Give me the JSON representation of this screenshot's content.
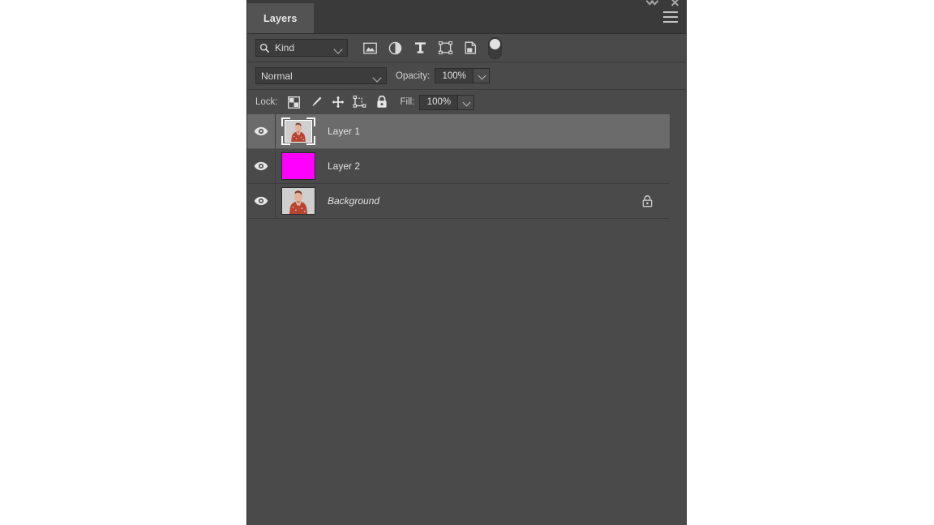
{
  "window": {
    "collapse_icon": "collapse-arrows-icon",
    "close_icon": "close-icon"
  },
  "panel": {
    "tab_label": "Layers",
    "menu_icon": "hamburger-menu-icon",
    "accent_selected_row": "#6b6b6b",
    "background": "#4a4a4a"
  },
  "filter": {
    "search_icon": "search-icon",
    "kind_label": "Kind",
    "kind_chevron": "chevron-down-icon",
    "icons": [
      {
        "name": "filter-pixel-layers-icon",
        "title": "Pixel layers"
      },
      {
        "name": "filter-adjustment-layers-icon",
        "title": "Adjustment layers"
      },
      {
        "name": "filter-type-layers-icon",
        "title": "Type layers"
      },
      {
        "name": "filter-shape-layers-icon",
        "title": "Shape layers"
      },
      {
        "name": "filter-smart-object-layers-icon",
        "title": "Smart objects"
      }
    ],
    "toggle": {
      "name": "filter-enable-toggle",
      "state": "on"
    }
  },
  "blend": {
    "mode": "Normal",
    "mode_chevron": "chevron-down-icon",
    "opacity_label": "Opacity:",
    "opacity_value": "100%",
    "opacity_chevron": "chevron-down-icon"
  },
  "lock": {
    "label": "Lock:",
    "icons": [
      {
        "name": "lock-transparent-pixels-icon"
      },
      {
        "name": "lock-image-pixels-icon"
      },
      {
        "name": "lock-position-icon"
      },
      {
        "name": "lock-artboard-nesting-icon"
      },
      {
        "name": "lock-all-icon"
      }
    ],
    "fill_label": "Fill:",
    "fill_value": "100%",
    "fill_chevron": "chevron-down-icon"
  },
  "layers": [
    {
      "name": "Layer 1",
      "visible": true,
      "selected": true,
      "locked": false,
      "italic": false,
      "thumb_type": "portrait-with-transform-brackets",
      "thumb_color": "#c9a094"
    },
    {
      "name": "Layer 2",
      "visible": true,
      "selected": false,
      "locked": false,
      "italic": false,
      "thumb_type": "solid-color",
      "thumb_color": "#ff00ff"
    },
    {
      "name": "Background",
      "visible": true,
      "selected": false,
      "locked": true,
      "italic": true,
      "thumb_type": "portrait",
      "thumb_color": "#c9a094"
    }
  ]
}
